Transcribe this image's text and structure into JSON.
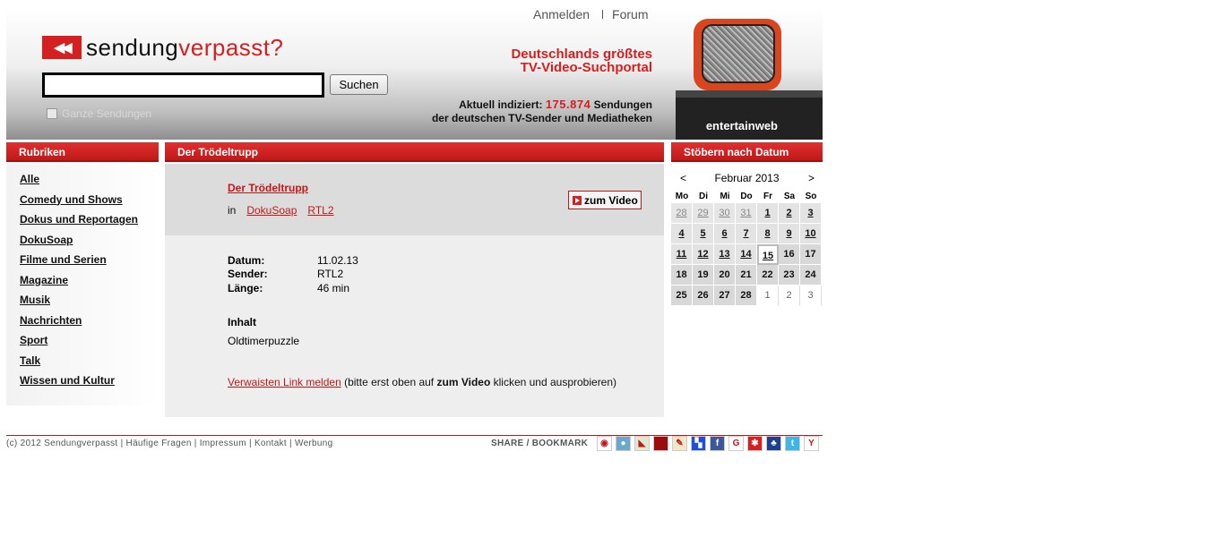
{
  "header": {
    "logo_part1": "sendung",
    "logo_part2": "verpasst?",
    "logo_icon": "◀◀",
    "search_placeholder": "",
    "search_button": "Suchen",
    "checkbox_label": "Ganze Sendungen",
    "toplinks": [
      "Anmelden",
      "Forum"
    ],
    "slogan_line1": "Deutschlands größtes",
    "slogan_line2": "TV-Video-Suchportal",
    "indexed_prefix": "Aktuell indiziert:",
    "indexed_count": "175.874",
    "indexed_suffix": "Sendungen",
    "indexed_line2": "der deutschen TV-Sender und Mediatheken",
    "tv_brand": "entertainweb"
  },
  "colors": {
    "accent": "#d42020"
  },
  "nav": {
    "title": "Rubriken",
    "items": [
      "Alle",
      "Comedy und Shows",
      "Dokus und Reportagen",
      "DokuSoap",
      "Filme und Serien",
      "Magazine",
      "Musik",
      "Nachrichten",
      "Sport",
      "Talk",
      "Wissen und Kultur"
    ]
  },
  "main": {
    "section_title": "Der Trödeltrupp",
    "show_title": "Der Trödeltrupp",
    "in_label": "in",
    "category": "DokuSoap",
    "channel": "RTL2",
    "video_button": "zum Video",
    "details": [
      {
        "label": "Datum:",
        "value": "11.02.13"
      },
      {
        "label": "Sender:",
        "value": "RTL2"
      },
      {
        "label": "Länge:",
        "value": "46 min"
      }
    ],
    "content_heading": "Inhalt",
    "content_text": "Oldtimerpuzzle",
    "report_link": "Verwaisten Link melden",
    "report_text1": " (bitte erst oben auf ",
    "report_bold": "zum Video",
    "report_text2": " klicken und ausprobieren)"
  },
  "calendar": {
    "title": "Stöbern nach Datum",
    "prev": "<",
    "next": ">",
    "month": "Februar 2013",
    "weekdays": [
      "Mo",
      "Di",
      "Mi",
      "Do",
      "Fr",
      "Sa",
      "So"
    ],
    "days": [
      {
        "d": "28",
        "t": "prev"
      },
      {
        "d": "29",
        "t": "prev"
      },
      {
        "d": "30",
        "t": "prev"
      },
      {
        "d": "31",
        "t": "prev"
      },
      {
        "d": "1",
        "t": "link"
      },
      {
        "d": "2",
        "t": "link"
      },
      {
        "d": "3",
        "t": "link"
      },
      {
        "d": "4",
        "t": "link"
      },
      {
        "d": "5",
        "t": "link"
      },
      {
        "d": "6",
        "t": "link"
      },
      {
        "d": "7",
        "t": "link"
      },
      {
        "d": "8",
        "t": "link"
      },
      {
        "d": "9",
        "t": "link"
      },
      {
        "d": "10",
        "t": "link"
      },
      {
        "d": "11",
        "t": "link"
      },
      {
        "d": "12",
        "t": "link"
      },
      {
        "d": "13",
        "t": "link"
      },
      {
        "d": "14",
        "t": "link"
      },
      {
        "d": "15",
        "t": "today"
      },
      {
        "d": "16",
        "t": "future"
      },
      {
        "d": "17",
        "t": "future"
      },
      {
        "d": "18",
        "t": "future"
      },
      {
        "d": "19",
        "t": "future"
      },
      {
        "d": "20",
        "t": "future"
      },
      {
        "d": "21",
        "t": "future"
      },
      {
        "d": "22",
        "t": "future"
      },
      {
        "d": "23",
        "t": "future"
      },
      {
        "d": "24",
        "t": "future"
      },
      {
        "d": "25",
        "t": "future"
      },
      {
        "d": "26",
        "t": "future"
      },
      {
        "d": "27",
        "t": "future"
      },
      {
        "d": "28",
        "t": "future"
      },
      {
        "d": "1",
        "t": "next"
      },
      {
        "d": "2",
        "t": "next"
      },
      {
        "d": "3",
        "t": "next"
      }
    ]
  },
  "footer": {
    "copyright": "(c) 2012 Sendungverpasst | Häufige Fragen | Impressum | Kontakt | Werbung",
    "share_label": "SHARE / BOOKMARK",
    "bookmark_icons": [
      {
        "name": "bookmark-icon-1",
        "color": "#ffffff",
        "glyph": "◉"
      },
      {
        "name": "bookmark-icon-2",
        "color": "#6aa9c9",
        "glyph": "●"
      },
      {
        "name": "bookmark-icon-3",
        "color": "#dfe8d0",
        "glyph": "◣"
      },
      {
        "name": "bookmark-icon-4",
        "color": "#9b0d0d",
        "glyph": ""
      },
      {
        "name": "bookmark-icon-5",
        "color": "#f4e6c8",
        "glyph": "✎"
      },
      {
        "name": "delicious-icon",
        "color": "#1d4fd8",
        "glyph": "▚"
      },
      {
        "name": "facebook-icon",
        "color": "#3b5998",
        "glyph": "f"
      },
      {
        "name": "google-icon",
        "color": "#ffffff",
        "glyph": "G"
      },
      {
        "name": "bookmark-icon-9",
        "color": "#d42020",
        "glyph": "✱"
      },
      {
        "name": "myspace-icon",
        "color": "#1c3f8f",
        "glyph": "♣"
      },
      {
        "name": "twitter-icon",
        "color": "#3fb7e6",
        "glyph": "t"
      },
      {
        "name": "yahoo-icon",
        "color": "#ffffff",
        "glyph": "Y"
      }
    ]
  }
}
